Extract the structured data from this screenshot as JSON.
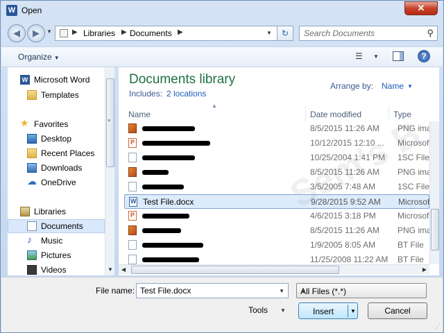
{
  "window": {
    "title": "Open",
    "app_icon": "W",
    "close_glyph": "✕"
  },
  "nav": {
    "back_glyph": "◀",
    "forward_glyph": "▶",
    "breadcrumbs": [
      "Libraries",
      "Documents"
    ],
    "refresh_glyph": "↻",
    "search_placeholder": "Search Documents"
  },
  "toolbar": {
    "organize_label": "Organize",
    "views_glyph": "☰",
    "help_glyph": "?"
  },
  "sidebar": {
    "items": [
      {
        "label": "Microsoft Word",
        "icon": "word-icon"
      },
      {
        "label": "Templates",
        "icon": "folder-icon"
      },
      {
        "label": "Favorites",
        "icon": "star-icon"
      },
      {
        "label": "Desktop",
        "icon": "desktop-icon"
      },
      {
        "label": "Recent Places",
        "icon": "recent-places-icon"
      },
      {
        "label": "Downloads",
        "icon": "downloads-icon"
      },
      {
        "label": "OneDrive",
        "icon": "cloud-icon"
      },
      {
        "label": "Libraries",
        "icon": "libraries-icon"
      },
      {
        "label": "Documents",
        "icon": "documents-icon",
        "selected": true
      },
      {
        "label": "Music",
        "icon": "music-icon"
      },
      {
        "label": "Pictures",
        "icon": "pictures-icon"
      },
      {
        "label": "Videos",
        "icon": "videos-icon"
      }
    ]
  },
  "library": {
    "title": "Documents library",
    "includes_label": "Includes:",
    "includes_link": "2 locations",
    "arrange_label": "Arrange by:",
    "arrange_value": "Name"
  },
  "columns": {
    "name": "Name",
    "date": "Date modified",
    "type": "Type"
  },
  "files": [
    {
      "name": "",
      "redacted": true,
      "icon": "png",
      "date": "8/5/2015 11:26 AM",
      "type": "PNG imag"
    },
    {
      "name": "",
      "redacted": true,
      "icon": "pptx",
      "date": "10/12/2015 12:10 ...",
      "type": "Microsoft"
    },
    {
      "name": "",
      "redacted": true,
      "icon": "blank",
      "date": "10/25/2004 1:41 PM",
      "type": "1SC File"
    },
    {
      "name": "",
      "redacted": true,
      "icon": "png",
      "date": "8/5/2015 11:26 AM",
      "type": "PNG imag"
    },
    {
      "name": "",
      "redacted": true,
      "icon": "blank",
      "date": "3/5/2005 7:48 AM",
      "type": "1SC File"
    },
    {
      "name": "Test File.docx",
      "redacted": false,
      "icon": "docx",
      "date": "9/28/2015 9:52 AM",
      "type": "Microsoft",
      "selected": true
    },
    {
      "name": "",
      "redacted": true,
      "icon": "pptx",
      "date": "4/6/2015 3:18 PM",
      "type": "Microsoft"
    },
    {
      "name": "",
      "redacted": true,
      "icon": "png",
      "date": "8/5/2015 11:26 AM",
      "type": "PNG imag"
    },
    {
      "name": "",
      "redacted": true,
      "icon": "blank",
      "date": "1/9/2005 8:05 AM",
      "type": "BT File"
    },
    {
      "name": "",
      "redacted": true,
      "icon": "blank",
      "date": "11/25/2008 11:22 AM",
      "type": "BT File"
    }
  ],
  "watermark": "Sem's B",
  "footer": {
    "file_name_label": "File name:",
    "file_name_value": "Test File.docx",
    "filter_value": "All Files (*.*)",
    "tools_label": "Tools",
    "insert_label": "Insert",
    "cancel_label": "Cancel"
  }
}
